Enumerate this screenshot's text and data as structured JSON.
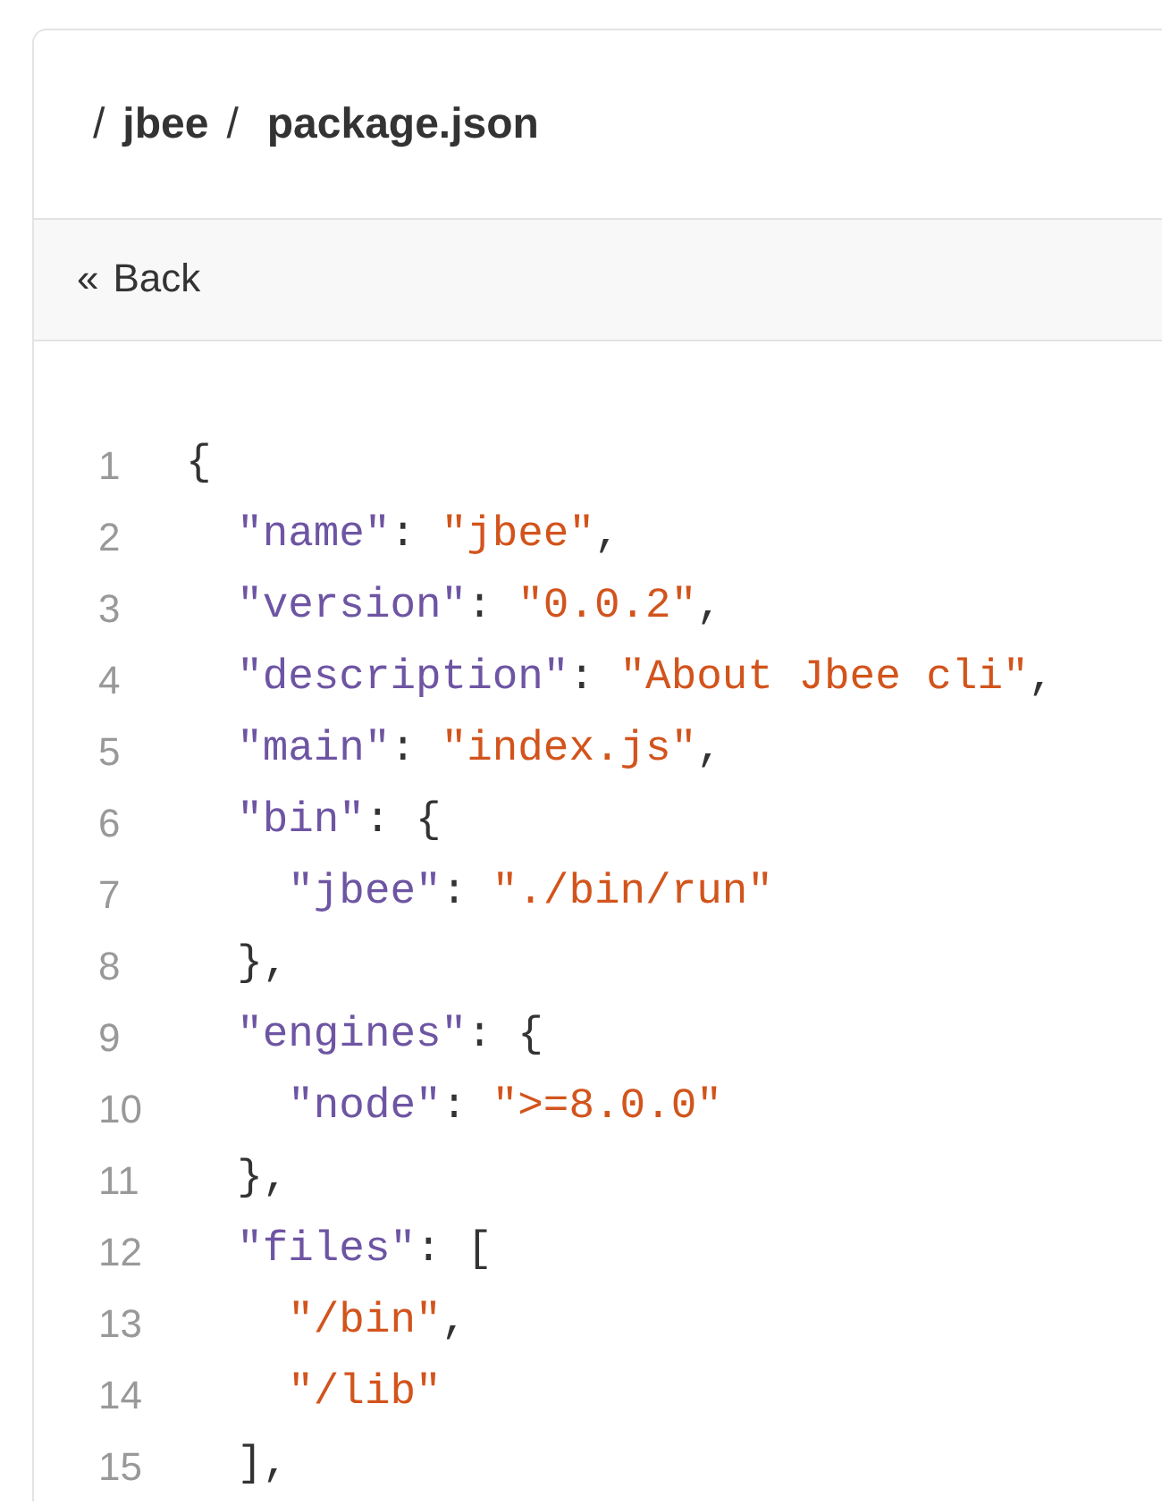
{
  "breadcrumb": [
    {
      "separator": "/",
      "label": "jbee"
    },
    {
      "separator": "/",
      "label": "package.json"
    }
  ],
  "back": {
    "icon": "«",
    "label": "Back"
  },
  "code_lines": [
    {
      "number": "1",
      "tokens": [
        {
          "kind": "punct",
          "text": "{"
        }
      ]
    },
    {
      "number": "2",
      "tokens": [
        {
          "kind": "key",
          "text": "  \"name\""
        },
        {
          "kind": "punct",
          "text": ": "
        },
        {
          "kind": "string",
          "text": "\"jbee\""
        },
        {
          "kind": "punct",
          "text": ","
        }
      ]
    },
    {
      "number": "3",
      "tokens": [
        {
          "kind": "key",
          "text": "  \"version\""
        },
        {
          "kind": "punct",
          "text": ": "
        },
        {
          "kind": "string",
          "text": "\"0.0.2\""
        },
        {
          "kind": "punct",
          "text": ","
        }
      ]
    },
    {
      "number": "4",
      "tokens": [
        {
          "kind": "key",
          "text": "  \"description\""
        },
        {
          "kind": "punct",
          "text": ": "
        },
        {
          "kind": "string",
          "text": "\"About Jbee cli\""
        },
        {
          "kind": "punct",
          "text": ","
        }
      ]
    },
    {
      "number": "5",
      "tokens": [
        {
          "kind": "key",
          "text": "  \"main\""
        },
        {
          "kind": "punct",
          "text": ": "
        },
        {
          "kind": "string",
          "text": "\"index.js\""
        },
        {
          "kind": "punct",
          "text": ","
        }
      ]
    },
    {
      "number": "6",
      "tokens": [
        {
          "kind": "key",
          "text": "  \"bin\""
        },
        {
          "kind": "punct",
          "text": ": {"
        }
      ]
    },
    {
      "number": "7",
      "tokens": [
        {
          "kind": "key",
          "text": "    \"jbee\""
        },
        {
          "kind": "punct",
          "text": ": "
        },
        {
          "kind": "string",
          "text": "\"./bin/run\""
        }
      ]
    },
    {
      "number": "8",
      "tokens": [
        {
          "kind": "punct",
          "text": "  },"
        }
      ]
    },
    {
      "number": "9",
      "tokens": [
        {
          "kind": "key",
          "text": "  \"engines\""
        },
        {
          "kind": "punct",
          "text": ": {"
        }
      ]
    },
    {
      "number": "10",
      "tokens": [
        {
          "kind": "key",
          "text": "    \"node\""
        },
        {
          "kind": "punct",
          "text": ": "
        },
        {
          "kind": "string",
          "text": "\">=8.0.0\""
        }
      ]
    },
    {
      "number": "11",
      "tokens": [
        {
          "kind": "punct",
          "text": "  },"
        }
      ]
    },
    {
      "number": "12",
      "tokens": [
        {
          "kind": "key",
          "text": "  \"files\""
        },
        {
          "kind": "punct",
          "text": ": ["
        }
      ]
    },
    {
      "number": "13",
      "tokens": [
        {
          "kind": "string",
          "text": "    \"/bin\""
        },
        {
          "kind": "punct",
          "text": ","
        }
      ]
    },
    {
      "number": "14",
      "tokens": [
        {
          "kind": "string",
          "text": "    \"/lib\""
        }
      ]
    },
    {
      "number": "15",
      "tokens": [
        {
          "kind": "punct",
          "text": "  ],"
        }
      ]
    }
  ]
}
